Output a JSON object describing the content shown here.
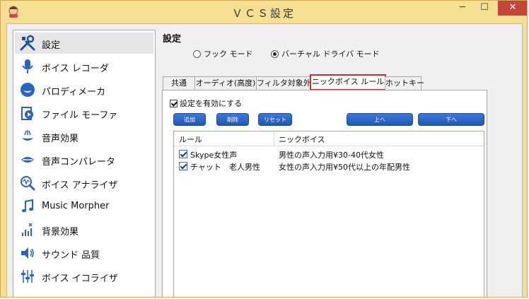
{
  "window": {
    "title": "ＶＣＳ設定",
    "min_symbol": "─",
    "max_symbol": "☐",
    "close_symbol": "✕"
  },
  "sidebar": {
    "items": [
      {
        "label": "設定",
        "icon": "tools-icon"
      },
      {
        "label": "ボイス レコーダ",
        "icon": "microphone-icon"
      },
      {
        "label": "パロディメーカ",
        "icon": "lips-icon"
      },
      {
        "label": "ファイル モーファ",
        "icon": "file-morph-icon"
      },
      {
        "label": "音声効果",
        "icon": "voice-effect-icon"
      },
      {
        "label": "音声コンパレータ",
        "icon": "comparator-icon"
      },
      {
        "label": "ボイス アナライザ",
        "icon": "analyzer-icon"
      },
      {
        "label": "Music Morpher",
        "icon": "music-note-icon"
      },
      {
        "label": "背景効果",
        "icon": "background-effect-icon"
      },
      {
        "label": "サウンド 品質",
        "icon": "speaker-icon"
      },
      {
        "label": "ボイス イコライザ",
        "icon": "equalizer-icon"
      }
    ]
  },
  "settings": {
    "title": "設定",
    "modes": [
      {
        "label": "フック モード",
        "selected": false
      },
      {
        "label": "バーチャル ドライバ モード",
        "selected": true
      }
    ]
  },
  "tabs": [
    {
      "label": "共通"
    },
    {
      "label": "オーディオ(高度)"
    },
    {
      "label": "フィルタ対象外"
    },
    {
      "label": "ニックボイス ルール",
      "active": true
    },
    {
      "label": "ホットキー"
    }
  ],
  "panel": {
    "enable_label": "設定を有効にする",
    "enable_checked": true,
    "buttons": {
      "add": "追加",
      "delete": "削除",
      "reset": "リセット",
      "up": "上へ",
      "down": "下へ"
    },
    "table": {
      "columns": [
        "ルール",
        "ニックボイス"
      ],
      "rows": [
        {
          "rule": "Skype女性声",
          "voice": "男性の声入力用¥30-40代女性",
          "checked": true
        },
        {
          "rule": "チャット　老人男性",
          "voice": "女性の声入力用¥50代以上の年配男性",
          "checked": true
        }
      ]
    }
  },
  "colors": {
    "frame": "#f7df92",
    "close": "#c7453a",
    "accent_button": "#2a64c8",
    "active_tab_outline": "#d22b2b"
  }
}
